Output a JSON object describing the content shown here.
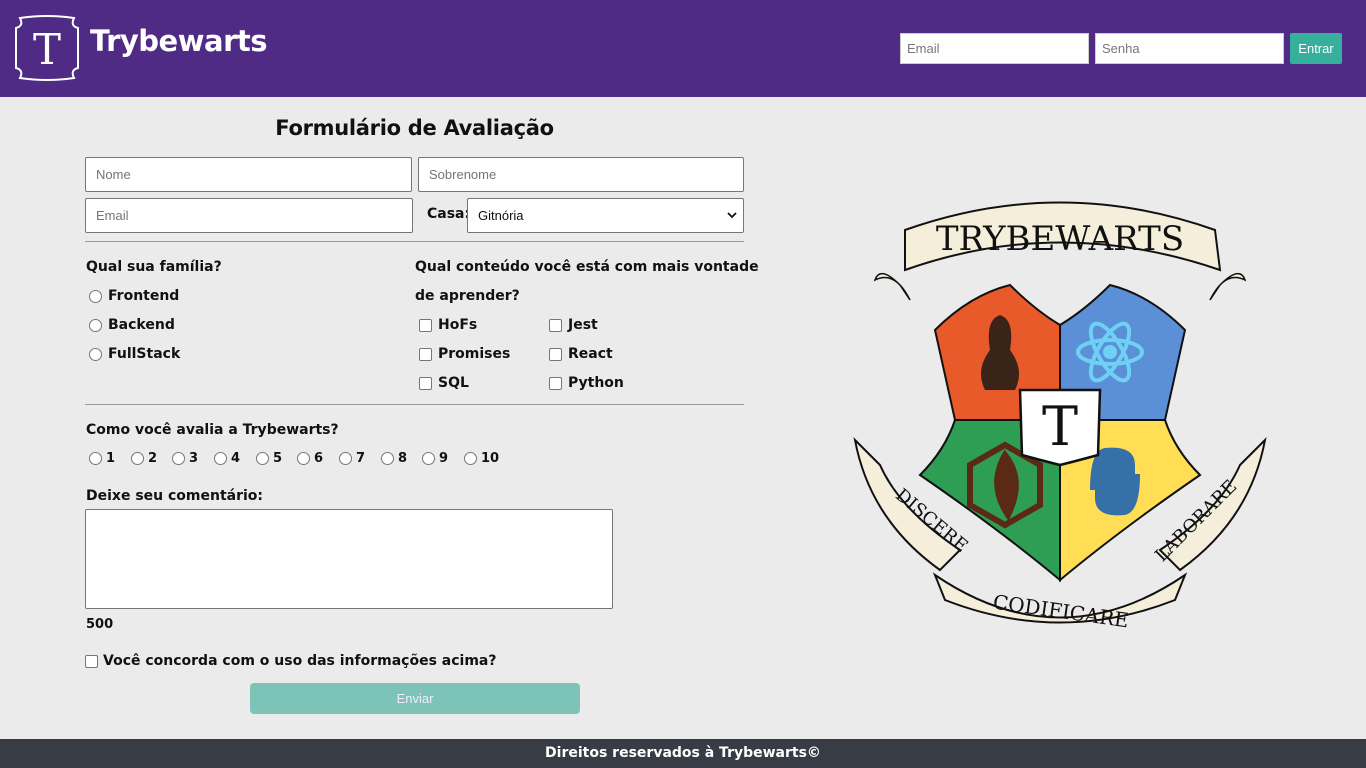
{
  "header": {
    "logo_letter": "T",
    "brand": "Trybewarts",
    "login": {
      "email_placeholder": "Email",
      "password_placeholder": "Senha",
      "button_label": "Entrar"
    }
  },
  "form": {
    "title": "Formulário de Avaliação",
    "nome_placeholder": "Nome",
    "sobrenome_placeholder": "Sobrenome",
    "email_placeholder": "Email",
    "casa_label": "Casa:",
    "casa_value": "Gitnória",
    "familia": {
      "question": "Qual sua família?",
      "options": [
        "Frontend",
        "Backend",
        "FullStack"
      ]
    },
    "conteudo": {
      "question_line1": "Qual conteúdo você está com mais vontade",
      "question_line2": "de aprender?",
      "options": [
        "HoFs",
        "Jest",
        "Promises",
        "React",
        "SQL",
        "Python"
      ]
    },
    "avaliacao": {
      "question": "Como você avalia a Trybewarts?",
      "options": [
        "1",
        "2",
        "3",
        "4",
        "5",
        "6",
        "7",
        "8",
        "9",
        "10"
      ]
    },
    "comment_label": "Deixe seu comentário:",
    "counter": "500",
    "agreement": "Você concorda com o uso das informações acima?",
    "submit_label": "Enviar"
  },
  "crest": {
    "banner_top": "TRYBEWARTS",
    "center_letter": "T",
    "motto_left": "DISCERE",
    "motto_bottom": "CODIFICARE",
    "motto_right": "LABORARE",
    "colors": {
      "top_left": "#e85a2a",
      "top_right": "#5b8fd6",
      "bottom_left": "#2f9e55",
      "bottom_right": "#ffdd55",
      "ribbon": "#f4eedb"
    }
  },
  "footer": {
    "text": "Direitos reservados à Trybewarts©"
  },
  "colors": {
    "header_bg": "#4f2b85",
    "accent": "#36b09c",
    "footer_bg": "#383d45",
    "page_bg": "#ebebeb"
  }
}
